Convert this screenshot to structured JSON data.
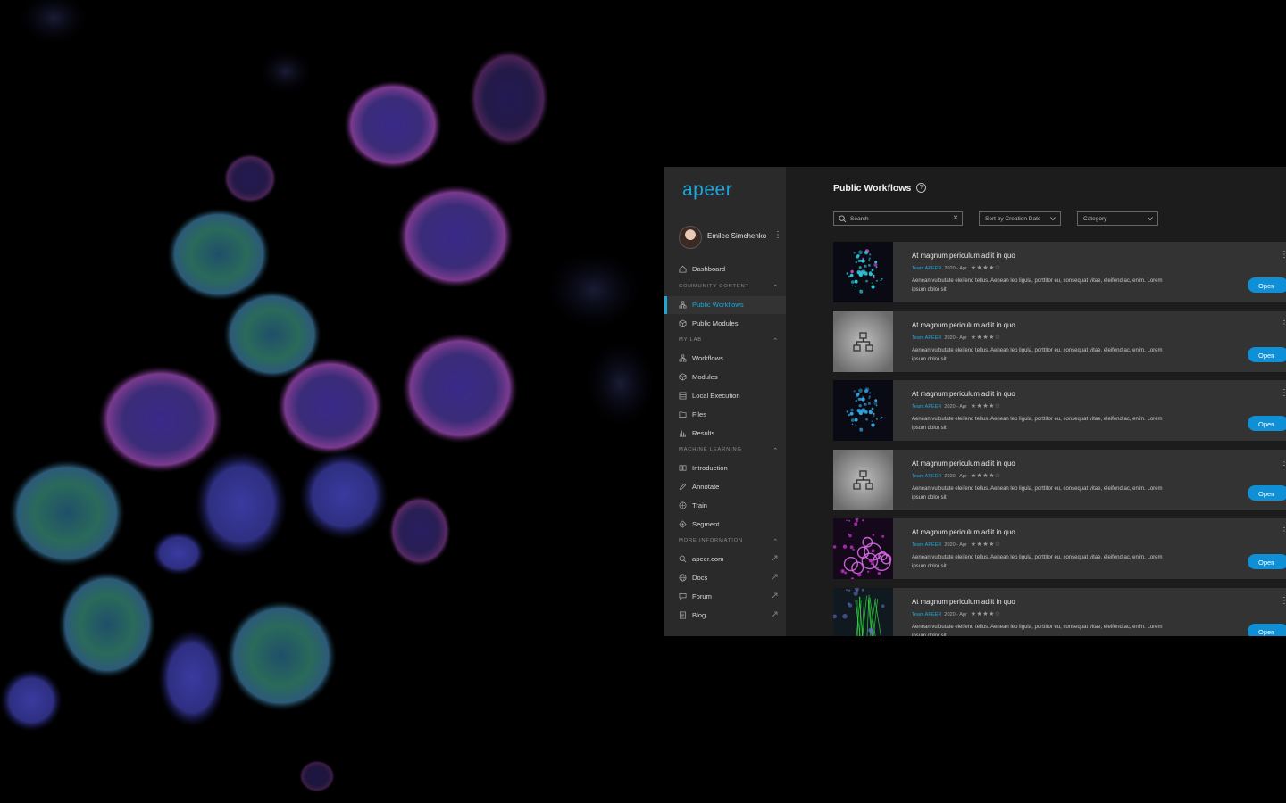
{
  "app": {
    "logo": "apeer",
    "user_name": "Emilee Simchenko",
    "accent_color": "#1ea6d9",
    "nav_top": [
      {
        "label": "Dashboard",
        "icon": "home-icon"
      }
    ],
    "sections": [
      {
        "title": "COMMUNITY CONTENT",
        "items": [
          {
            "label": "Public Workflows",
            "icon": "workflow-icon",
            "active": true
          },
          {
            "label": "Public Modules",
            "icon": "module-icon"
          }
        ]
      },
      {
        "title": "MY LAB",
        "items": [
          {
            "label": "Workflows",
            "icon": "workflow-icon"
          },
          {
            "label": "Modules",
            "icon": "module-icon"
          },
          {
            "label": "Local Execution",
            "icon": "server-icon"
          },
          {
            "label": "Files",
            "icon": "folder-icon"
          },
          {
            "label": "Results",
            "icon": "chart-icon"
          }
        ]
      },
      {
        "title": "MACHINE LEARNING",
        "items": [
          {
            "label": "Introduction",
            "icon": "intro-icon"
          },
          {
            "label": "Annotate",
            "icon": "pen-icon"
          },
          {
            "label": "Train",
            "icon": "brain-icon"
          },
          {
            "label": "Segment",
            "icon": "segment-icon"
          }
        ]
      },
      {
        "title": "MORE INFORMATION",
        "items": [
          {
            "label": "apeer.com",
            "icon": "search-icon",
            "external": true
          },
          {
            "label": "Docs",
            "icon": "globe-icon",
            "external": true
          },
          {
            "label": "Forum",
            "icon": "chat-icon",
            "external": true
          },
          {
            "label": "Blog",
            "icon": "document-icon",
            "external": true
          }
        ]
      }
    ]
  },
  "main": {
    "title": "Public Workflows",
    "search_placeholder": "Search",
    "sort_label": "Sort by Creation Date",
    "category_label": "Category",
    "cards": [
      {
        "title": "At magnum periculum adiit in quo",
        "team": "Team APEER",
        "date": "2020 - Apr",
        "stars": 4,
        "desc": "Aenean vulputate eleifend tellus. Aenean leo ligula, porttitor eu, consequat vitae, eleifend ac, enim. Lorem ipsum dolor sit",
        "thumb": "cells-cyan",
        "open": "Open"
      },
      {
        "title": "At magnum periculum adiit in quo",
        "team": "Team APEER",
        "date": "2020 - Apr",
        "stars": 4,
        "desc": "Aenean vulputate eleifend tellus. Aenean leo ligula, porttitor eu, consequat vitae, eleifend ac, enim. Lorem ipsum dolor sit",
        "thumb": "placeholder",
        "open": "Open"
      },
      {
        "title": "At magnum periculum adiit in quo",
        "team": "Team APEER",
        "date": "2020 - Apr",
        "stars": 4,
        "desc": "Aenean vulputate eleifend tellus. Aenean leo ligula, porttitor eu, consequat vitae, eleifend ac, enim. Lorem ipsum dolor sit",
        "thumb": "cells-blue",
        "open": "Open"
      },
      {
        "title": "At magnum periculum adiit in quo",
        "team": "Team APEER",
        "date": "2020 - Apr",
        "stars": 4,
        "desc": "Aenean vulputate eleifend tellus. Aenean leo ligula, porttitor eu, consequat vitae, eleifend ac, enim. Lorem ipsum dolor sit",
        "thumb": "placeholder",
        "open": "Open"
      },
      {
        "title": "At magnum periculum adiit in quo",
        "team": "Team APEER",
        "date": "2020 - Apr",
        "stars": 4,
        "desc": "Aenean vulputate eleifend tellus. Aenean leo ligula, porttitor eu, consequat vitae, eleifend ac, enim. Lorem ipsum dolor sit",
        "thumb": "cells-magenta",
        "open": "Open"
      },
      {
        "title": "At magnum periculum adiit in quo",
        "team": "Team APEER",
        "date": "2020 - Apr",
        "stars": 4,
        "desc": "Aenean vulputate eleifend tellus. Aenean leo ligula, porttitor eu, consequat vitae, eleifend ac, enim. Lorem ipsum dolor sit",
        "thumb": "neurons-green",
        "open": "Open"
      }
    ]
  }
}
